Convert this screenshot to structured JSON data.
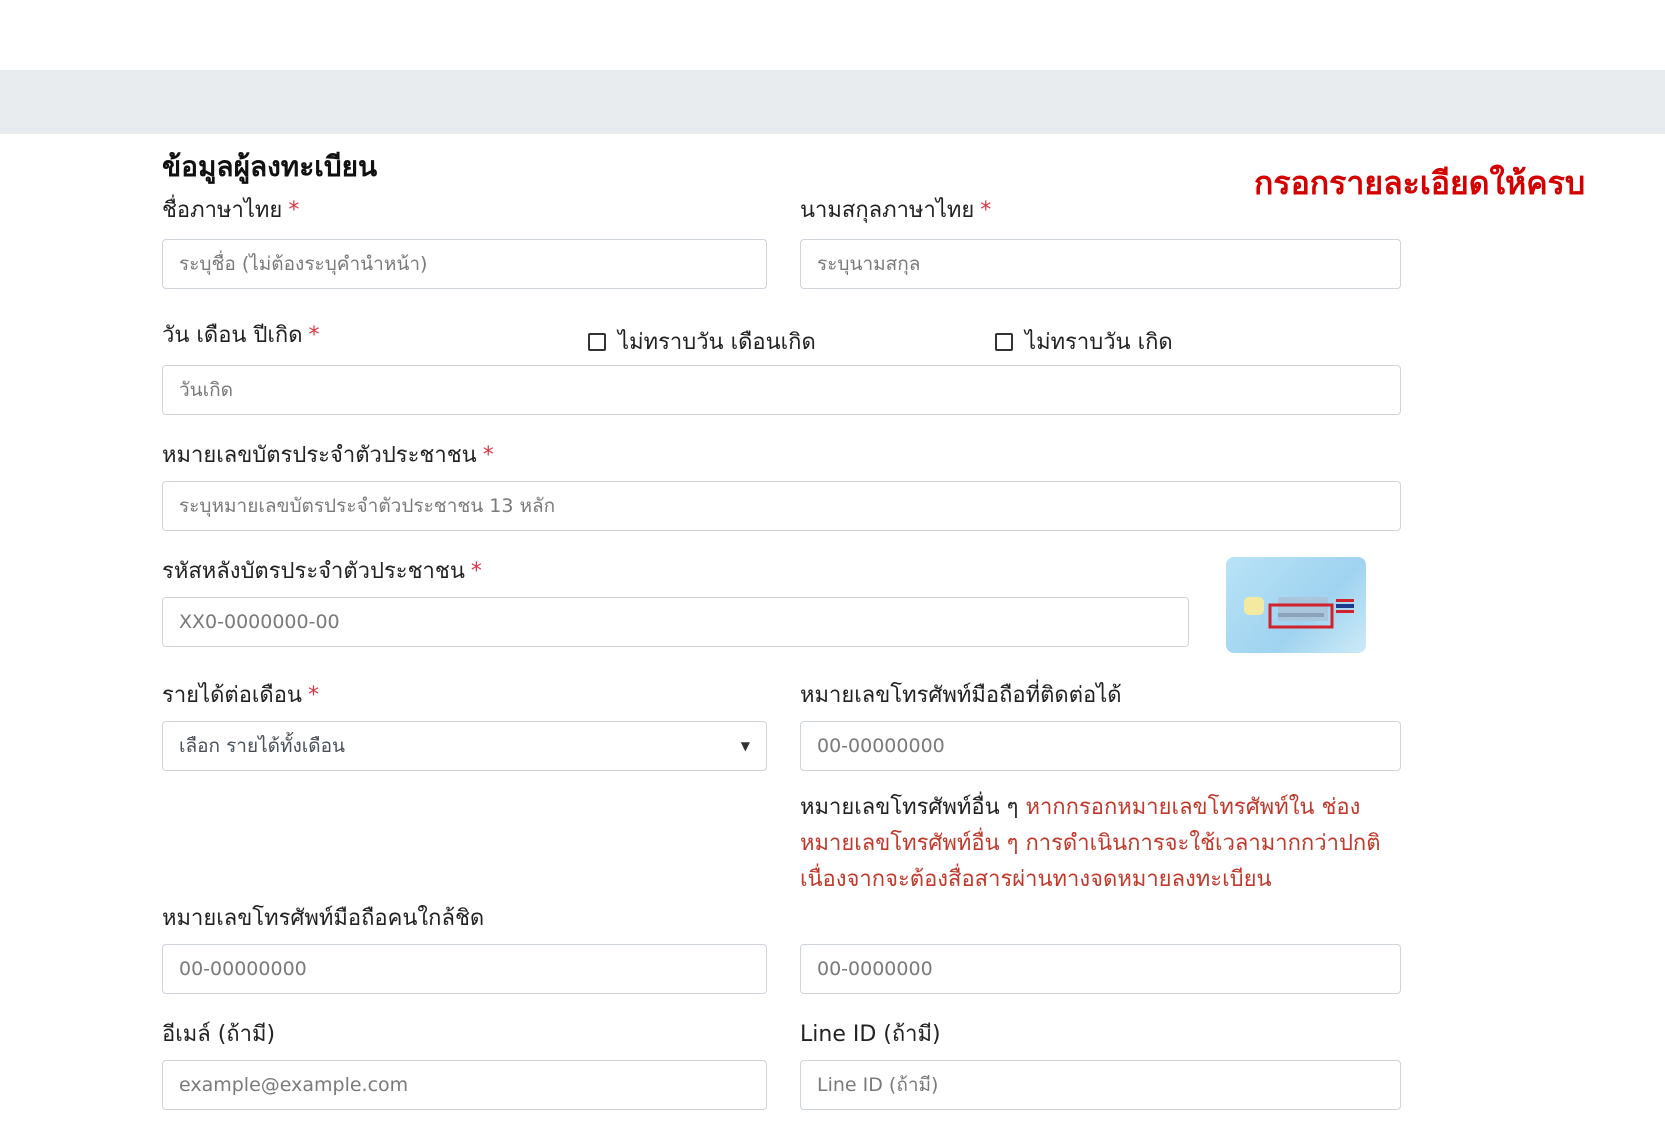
{
  "section_title": "ข้อมูลผู้ลงทะเบียน",
  "notice": "กรอกรายละเอียดให้ครบ",
  "required_mark": "*",
  "first_name": {
    "label": "ชื่อภาษาไทย",
    "placeholder": "ระบุชื่อ (ไม่ต้องระบุคำนำหน้า)"
  },
  "last_name": {
    "label": "นามสกุลภาษาไทย",
    "placeholder": "ระบุนามสกุล"
  },
  "birthdate": {
    "label": "วัน เดือน ปีเกิด",
    "placeholder": "วันเกิด",
    "unknown_day_month": "ไม่ทราบวัน เดือนเกิด",
    "unknown_day": "ไม่ทราบวัน เกิด"
  },
  "id_card": {
    "label": "หมายเลขบัตรประจำตัวประชาชน",
    "placeholder": "ระบุหมายเลขบัตรประจำตัวประชาชน 13 หลัก"
  },
  "laser_code": {
    "label": "รหัสหลังบัตรประจำตัวประชาชน",
    "placeholder": "XX0-0000000-00"
  },
  "income": {
    "label": "รายได้ต่อเดือน",
    "selected": "เลือก รายได้ทั้งเดือน",
    "caret": "▼"
  },
  "mobile": {
    "label": "หมายเลขโทรศัพท์มือถือที่ติดต่อได้",
    "placeholder": "00-00000000"
  },
  "other_phone": {
    "label": "หมายเลขโทรศัพท์อื่น ๆ",
    "note": "หากกรอกหมายเลขโทรศัพท์ใน ช่อง หมายเลขโทรศัพท์อื่น ๆ การดำเนินการจะใช้เวลามากกว่าปกติ เนื่องจากจะต้องสื่อสารผ่านทางจดหมายลงทะเบียน",
    "placeholder": "00-0000000"
  },
  "close_contact": {
    "label": "หมายเลขโทรศัพท์มือถือคนใกล้ชิด",
    "placeholder": "00-00000000"
  },
  "email": {
    "label": "อีเมล์ (ถ้ามี)",
    "placeholder": "example@example.com"
  },
  "line_id": {
    "label": "Line ID (ถ้ามี)",
    "placeholder": "Line ID (ถ้ามี)"
  }
}
